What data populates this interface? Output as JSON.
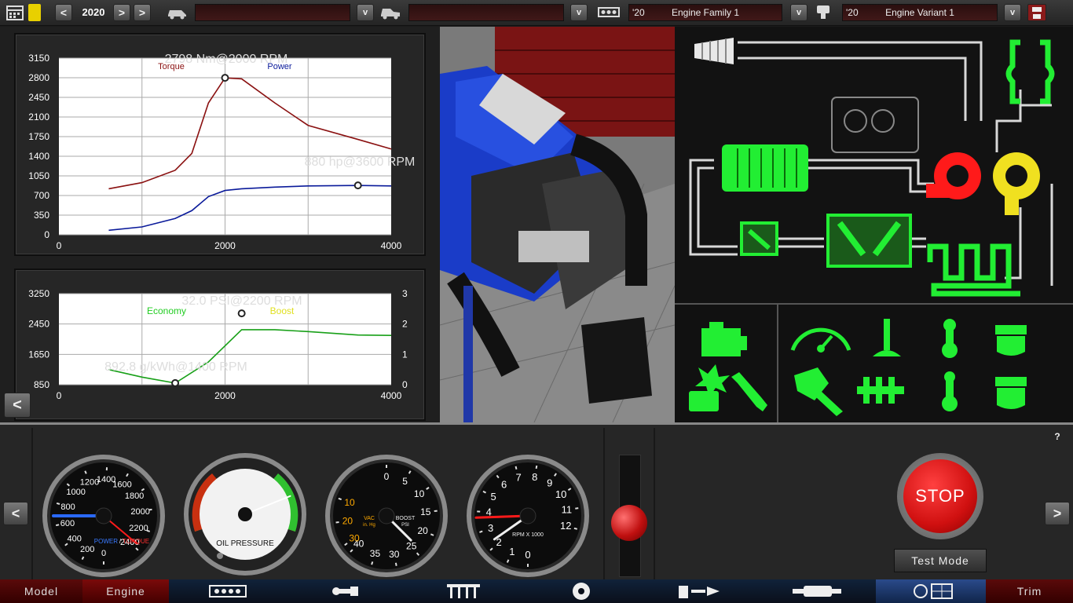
{
  "topbar": {
    "year": "2020",
    "prev_label": "<",
    "next_label": ">",
    "dropdown_label": "v",
    "family": {
      "year": "'20",
      "name": "Engine Family 1"
    },
    "variant": {
      "year": "'20",
      "name": "Engine Variant 1"
    }
  },
  "charts": {
    "torque_power": {
      "peak_torque": "2798 Nm@2000 RPM",
      "peak_power": "880 hp@3600 RPM",
      "legend_torque": "Torque",
      "legend_power": "Power",
      "colors": {
        "torque": "#8a1010",
        "power": "#0a1a9a"
      }
    },
    "economy_boost": {
      "peak_boost": "32.0 PSI@2200 RPM",
      "best_economy": "892.8 g/kWh@1400 RPM",
      "legend_economy": "Economy",
      "legend_boost": "Boost",
      "colors": {
        "economy": "#18a018",
        "boost": "#e0e020"
      }
    }
  },
  "chart_data": [
    {
      "type": "line",
      "x": [
        600,
        1000,
        1400,
        1600,
        1800,
        2000,
        2200,
        2600,
        3000,
        3600,
        4000
      ],
      "series": [
        {
          "name": "Torque",
          "values": [
            820,
            930,
            1150,
            1450,
            2350,
            2798,
            2780,
            2350,
            1950,
            1700,
            1530
          ]
        },
        {
          "name": "Power",
          "values": [
            80,
            140,
            290,
            430,
            680,
            790,
            820,
            850,
            870,
            880,
            870
          ]
        }
      ],
      "xlim": [
        0,
        4000
      ],
      "ylim": [
        0,
        3150
      ],
      "xticks": [
        "0",
        "2000",
        "4000"
      ],
      "yticks": [
        "0",
        "350",
        "700",
        "1050",
        "1400",
        "1750",
        "2100",
        "2450",
        "2800",
        "3150"
      ],
      "annotations": [
        "2798 Nm@2000 RPM",
        "880 hp@3600 RPM"
      ]
    },
    {
      "type": "line",
      "x": [
        600,
        1000,
        1400,
        1800,
        2200,
        2600,
        3000,
        3600,
        4000
      ],
      "series": [
        {
          "name": "Economy",
          "values": [
            1250,
            1050,
            892.8,
            1450,
            2300,
            2300,
            2250,
            2160,
            2150
          ]
        }
      ],
      "xlim": [
        0,
        4000
      ],
      "ylim": [
        850,
        3250
      ],
      "y2lim": [
        0,
        3
      ],
      "xticks": [
        "0",
        "2000",
        "4000"
      ],
      "yticks": [
        "850",
        "1650",
        "2450",
        "3250"
      ],
      "y2ticks": [
        "0",
        "1",
        "2",
        "3"
      ],
      "annotations": [
        "32.0 PSI@2200 RPM",
        "892.8 g/kWh@1400 RPM"
      ],
      "boost_point": {
        "x": 2200,
        "y": 32.0
      }
    }
  ],
  "gauges": {
    "dyno": {
      "ticks": [
        "0",
        "200",
        "400",
        "600",
        "800",
        "1000",
        "1200",
        "1400",
        "1600",
        "1800",
        "2000",
        "2200",
        "2400"
      ],
      "legend_power": "POWER",
      "legend_sep": "/",
      "legend_torque": "TORQUE"
    },
    "oil": {
      "label": "OIL PRESSURE"
    },
    "boost": {
      "boost_ticks": [
        "0",
        "5",
        "10",
        "15",
        "20",
        "25",
        "30",
        "35",
        "40"
      ],
      "vac_ticks": [
        "10",
        "20",
        "30"
      ],
      "vac_label": "VAC",
      "vac_unit": "in. Hg",
      "boost_label": "BOOST",
      "boost_unit": "PSI"
    },
    "tach": {
      "ticks": [
        "0",
        "1",
        "2",
        "3",
        "4",
        "5",
        "6",
        "7",
        "8",
        "9",
        "10",
        "11",
        "12"
      ],
      "label": "RPM X 1000"
    }
  },
  "dash": {
    "stop_label": "STOP",
    "test_mode_label": "Test Mode",
    "help_label": "?",
    "left_label": "<",
    "right_label": ">"
  },
  "nav": {
    "model": "Model",
    "engine": "Engine",
    "trim": "Trim"
  }
}
